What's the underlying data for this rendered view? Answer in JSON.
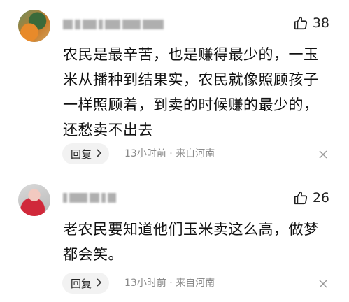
{
  "comments": [
    {
      "likes": "38",
      "text": "农民是最辛苦，也是赚得最少的，一玉米从播种到结果实，农民就像照顾孩子一样照顾着，到卖的时候赚的最少的，还愁卖不出去",
      "reply_label": "回复",
      "time": "13小时前",
      "separator": "·",
      "location": "来自河南"
    },
    {
      "likes": "26",
      "text": "老农民要知道他们玉米卖这么高，做梦都会笑。",
      "reply_label": "回复",
      "time": "13小时前",
      "separator": "·",
      "location": "来自河南"
    }
  ],
  "icons": {
    "like": "thumbs-up-icon",
    "reply_arrow": "chevron-right-icon",
    "close": "close-icon"
  }
}
